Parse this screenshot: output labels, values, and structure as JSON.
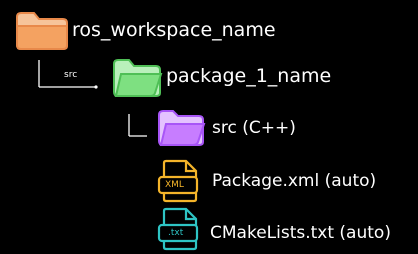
{
  "colors": {
    "background": "#000000",
    "text": "#ffffff",
    "workspace_folder": "#f4a261",
    "package_folder": "#7ee081",
    "src_folder": "#c77dff",
    "xml_file": "#f4b42a",
    "txt_file": "#2ec4c4",
    "connector": "#ffffff"
  },
  "tree": {
    "workspace": {
      "label": "ros_workspace_name",
      "icon": "folder-icon"
    },
    "package": {
      "label": "package_1_name",
      "icon": "folder-icon",
      "connector_label": "src"
    },
    "src": {
      "label": "src (C++)",
      "icon": "folder-icon"
    },
    "package_xml": {
      "label": "Package.xml (auto)",
      "icon": "file-icon",
      "badge": "XML"
    },
    "cmakelists": {
      "label": "CMakeLists.txt (auto)",
      "icon": "file-icon",
      "badge": ".txt"
    }
  }
}
